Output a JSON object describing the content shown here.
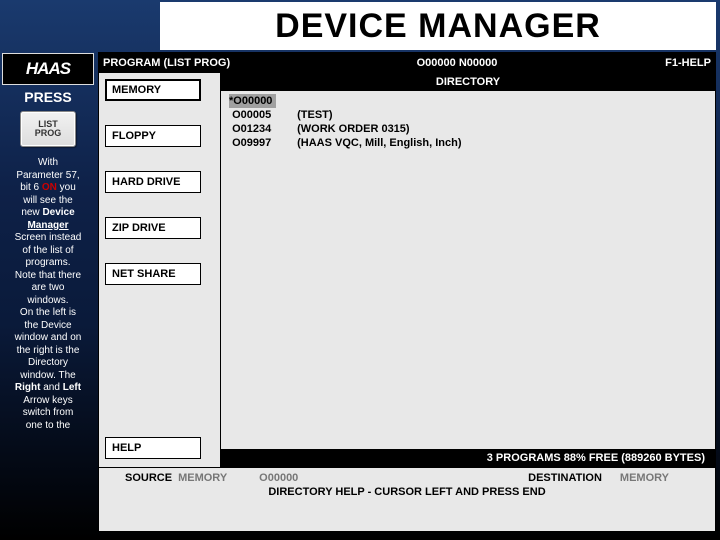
{
  "banner": {
    "title": "DEVICE MANAGER"
  },
  "logo": {
    "text": "HAAS"
  },
  "sidebar": {
    "press_label": "PRESS",
    "key_label": "LIST\nPROG",
    "paragraph": {
      "line1": "With",
      "line2_a": "Parameter 57,",
      "line3_a": "bit 6 ",
      "line3_on": "ON",
      "line3_b": " you",
      "line4": "will see the",
      "line5_a": "new ",
      "line5_b": "Device",
      "line6": "Manager",
      "line7": "Screen instead",
      "line8": "of the list of",
      "line9": "programs.",
      "line10": "Note that there",
      "line11": "are two",
      "line12": "windows.",
      "line13": "On the left is",
      "line14": "the Device",
      "line15": "window and on",
      "line16": "the right is the",
      "line17": "Directory",
      "line18": "window.  The",
      "line19_a": "Right",
      "line19_b": " and ",
      "line19_c": "Left",
      "line20": "Arrow keys",
      "line21": "switch from",
      "line22": "one to the"
    }
  },
  "screen": {
    "header": {
      "left": "PROGRAM  (LIST PROG)",
      "center": "O00000 N00000",
      "right": "F1-HELP"
    },
    "directory_label": "DIRECTORY",
    "devices": [
      {
        "label": "MEMORY",
        "selected": true
      },
      {
        "label": "FLOPPY",
        "selected": false
      },
      {
        "label": "HARD DRIVE",
        "selected": false
      },
      {
        "label": "ZIP DRIVE",
        "selected": false
      },
      {
        "label": "NET SHARE",
        "selected": false
      }
    ],
    "help_label": "HELP",
    "files": [
      {
        "selected": true,
        "star": "*",
        "num": "O00000",
        "desc": ""
      },
      {
        "selected": false,
        "star": "",
        "num": "O00005",
        "desc": "(TEST)"
      },
      {
        "selected": false,
        "star": "",
        "num": "O01234",
        "desc": "(WORK ORDER 0315)"
      },
      {
        "selected": false,
        "star": "",
        "num": "O09997",
        "desc": "(HAAS VQC, Mill, English, Inch)"
      }
    ],
    "status_line": "3 PROGRAMS 88% FREE (889260 BYTES)",
    "footer": {
      "source_label": "SOURCE",
      "source_value": "MEMORY",
      "source_prog": "O00000",
      "dest_label": "DESTINATION",
      "dest_value": "MEMORY",
      "help_line": "DIRECTORY HELP - CURSOR LEFT AND PRESS END"
    }
  }
}
